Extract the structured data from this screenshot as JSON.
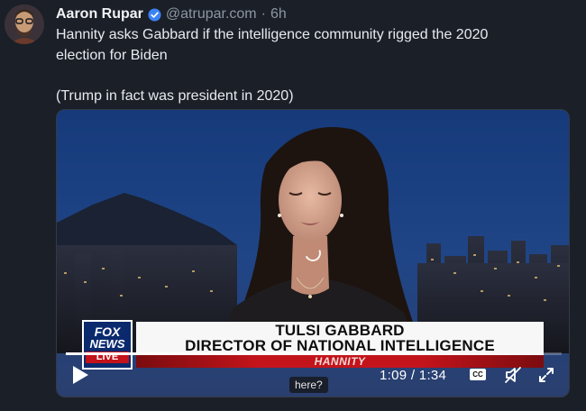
{
  "author": {
    "name": "Aaron Rupar",
    "handle": "@atrupar.com",
    "separator": "·",
    "time": "6h"
  },
  "post": {
    "line1": "Hannity asks Gabbard if the intelligence community rigged the 2020",
    "line2": "election for Biden",
    "line3": "(Trump in fact was president in 2020)"
  },
  "video": {
    "chyron": {
      "logo_line1": "FOX",
      "logo_line2": "NEWS",
      "logo_line3": "LIVE",
      "name": "TULSI GABBARD",
      "title": "DIRECTOR OF NATIONAL INTELLIGENCE",
      "show": "HANNITY"
    },
    "time_display": "1:09 / 1:34",
    "progress": 0.734,
    "cc_label": "CC",
    "caption": "here?",
    "icons": {
      "play": "play-icon",
      "cc": "closed-captions-icon",
      "mute": "speaker-muted-icon",
      "fullscreen": "fullscreen-icon",
      "loading": "loading-spinner-icon",
      "verified": "verified-badge-icon"
    },
    "colors": {
      "fox_blue": "#0b2a6e",
      "fox_red": "#c2121a",
      "verified_blue": "#3b82f6"
    }
  }
}
